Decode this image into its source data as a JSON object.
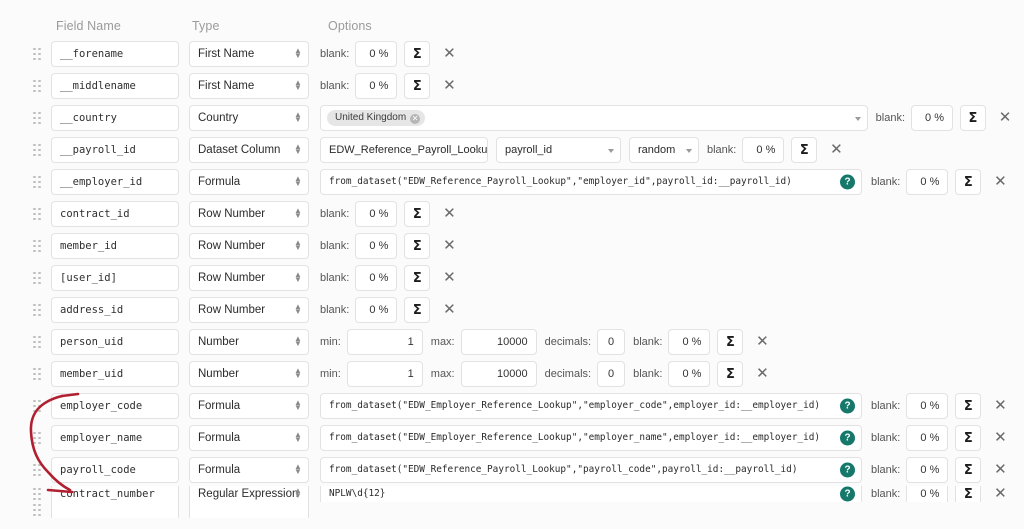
{
  "header": {
    "col_field_name": "Field Name",
    "col_type": "Type",
    "col_options": "Options"
  },
  "labels": {
    "blank": "blank:",
    "min": "min:",
    "max": "max:",
    "decimals": "decimals:",
    "sigma": "Σ",
    "close": "✕",
    "help": "?",
    "chip_remove": "✕",
    "spin_up": "∧",
    "spin_down": "∨"
  },
  "colors": {
    "accent_help": "#16786b",
    "annotation": "#b02030",
    "border": "#e2e2e2",
    "page_bg": "#fbfbfb",
    "muted_text": "#9b9b9b"
  },
  "rows": [
    {
      "field_name": "__forename",
      "type": "First Name",
      "option_kind": "blank",
      "blank": "0 %"
    },
    {
      "field_name": "__middlename",
      "type": "First Name",
      "option_kind": "blank",
      "blank": "0 %"
    },
    {
      "field_name": "__country",
      "type": "Country",
      "option_kind": "country",
      "chip": "United Kingdom",
      "blank": "0 %"
    },
    {
      "field_name": "__payroll_id",
      "type": "Dataset Column",
      "option_kind": "dataset_column",
      "dataset": "EDW_Reference_Payroll_Lookup",
      "column": "payroll_id",
      "mode": "random",
      "blank": "0 %"
    },
    {
      "field_name": "__employer_id",
      "type": "Formula",
      "option_kind": "formula",
      "formula": "from_dataset(\"EDW_Reference_Payroll_Lookup\",\"employer_id\",payroll_id:__payroll_id)",
      "blank": "0 %"
    },
    {
      "field_name": "contract_id",
      "type": "Row Number",
      "option_kind": "blank",
      "blank": "0 %"
    },
    {
      "field_name": "member_id",
      "type": "Row Number",
      "option_kind": "blank",
      "blank": "0 %"
    },
    {
      "field_name": "[user_id]",
      "type": "Row Number",
      "option_kind": "blank",
      "blank": "0 %"
    },
    {
      "field_name": "address_id",
      "type": "Row Number",
      "option_kind": "blank",
      "blank": "0 %"
    },
    {
      "field_name": "person_uid",
      "type": "Number",
      "option_kind": "number",
      "min": "1",
      "max": "10000",
      "decimals": "0",
      "blank": "0 %"
    },
    {
      "field_name": "member_uid",
      "type": "Number",
      "option_kind": "number",
      "min": "1",
      "max": "10000",
      "decimals": "0",
      "blank": "0 %"
    },
    {
      "field_name": "employer_code",
      "type": "Formula",
      "option_kind": "formula",
      "formula": "from_dataset(\"EDW_Employer_Reference_Lookup\",\"employer_code\",employer_id:__employer_id)",
      "blank": "0 %"
    },
    {
      "field_name": "employer_name",
      "type": "Formula",
      "option_kind": "formula",
      "formula": "from_dataset(\"EDW_Employer_Reference_Lookup\",\"employer_name\",employer_id:__employer_id)",
      "blank": "0 %"
    },
    {
      "field_name": "payroll_code",
      "type": "Formula",
      "option_kind": "formula",
      "formula": "from_dataset(\"EDW_Reference_Payroll_Lookup\",\"payroll_code\",payroll_id:__payroll_id)",
      "blank": "0 %"
    },
    {
      "field_name": "contract_number",
      "type": "Regular Expression",
      "option_kind": "regex",
      "regex": "NPLW\\d{12}",
      "blank": "0 %"
    }
  ],
  "annotation": {
    "kind": "hand-drawn-bracket",
    "marks_rows": [
      "employer_code",
      "employer_name",
      "payroll_code"
    ]
  }
}
